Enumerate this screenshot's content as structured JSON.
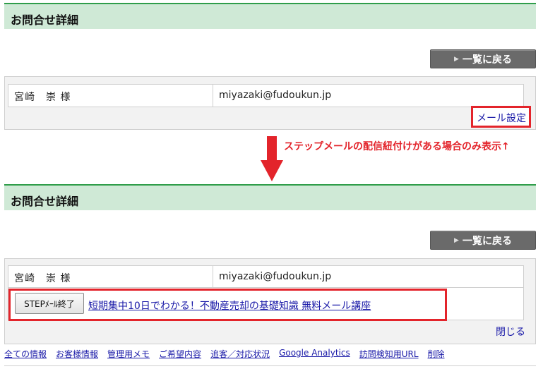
{
  "top": {
    "title": "お問合せ詳細",
    "back_button": "一覧に戻る",
    "customer_name": "宮崎　崇 様",
    "email": "miyazaki@fudoukun.jp",
    "mail_setting_link": "メール設定"
  },
  "annotation": {
    "note": "ステップメールの配信紐付けがある場合のみ表示↑",
    "arrow_color": "#e3242b"
  },
  "bottom": {
    "title": "お問合せ詳細",
    "back_button": "一覧に戻る",
    "customer_name": "宮崎　崇 様",
    "email": "miyazaki@fudoukun.jp",
    "step_end_button": "STEPﾒｰﾙ終了",
    "step_mail_link": "短期集中10日でわかる！不動産売却の基礎知識 無料メール講座",
    "close_link": "閉じる"
  },
  "footer": {
    "links": [
      "全ての情報",
      "お客様情報",
      "管理用メモ",
      "ご希望内容",
      "追客／対応状況",
      "Google Analytics",
      "訪問検知用URL",
      "削除"
    ]
  },
  "colors": {
    "header_bg": "#cfe9d6",
    "header_border": "#2f9d4a",
    "highlight_red": "#e3242b",
    "link_blue": "#1a1aa8"
  }
}
